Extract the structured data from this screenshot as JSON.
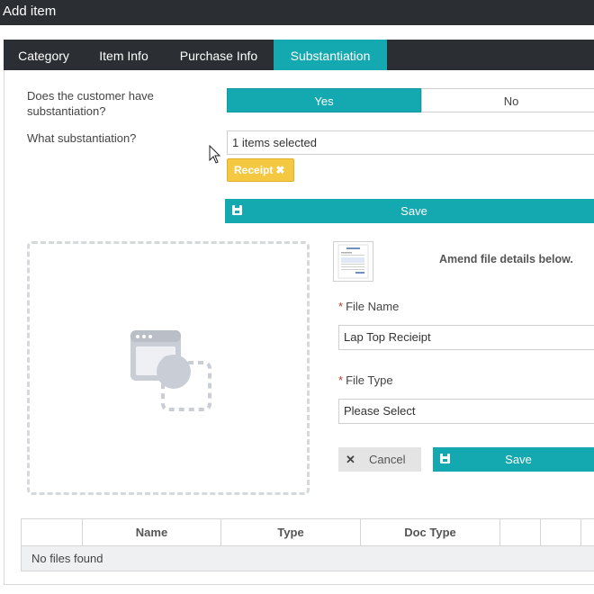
{
  "window": {
    "title": "Add item"
  },
  "tabs": [
    {
      "label": "Category"
    },
    {
      "label": "Item Info"
    },
    {
      "label": "Purchase Info"
    },
    {
      "label": "Substantiation"
    }
  ],
  "substantiation": {
    "question1": "Does the customer have substantiation?",
    "yes_label": "Yes",
    "no_label": "No",
    "question2": "What substantiation?",
    "selected_text": "1 items selected",
    "chip_label": "Receipt",
    "save_label": "Save"
  },
  "file_details": {
    "amend_text": "Amend file details below.",
    "file_name_label": "File Name",
    "file_name_value": "Lap Top Recieipt",
    "file_type_label": "File Type",
    "file_type_value": "Please Select",
    "required_mark": "*",
    "cancel_label": "Cancel",
    "save_label": "Save"
  },
  "files_table": {
    "columns": [
      "",
      "Name",
      "Type",
      "Doc Type",
      "",
      "",
      ""
    ],
    "empty_text": "No files found"
  },
  "colors": {
    "accent": "#14a9b0",
    "header_bg": "#2b2f33",
    "chip": "#f5c842"
  }
}
